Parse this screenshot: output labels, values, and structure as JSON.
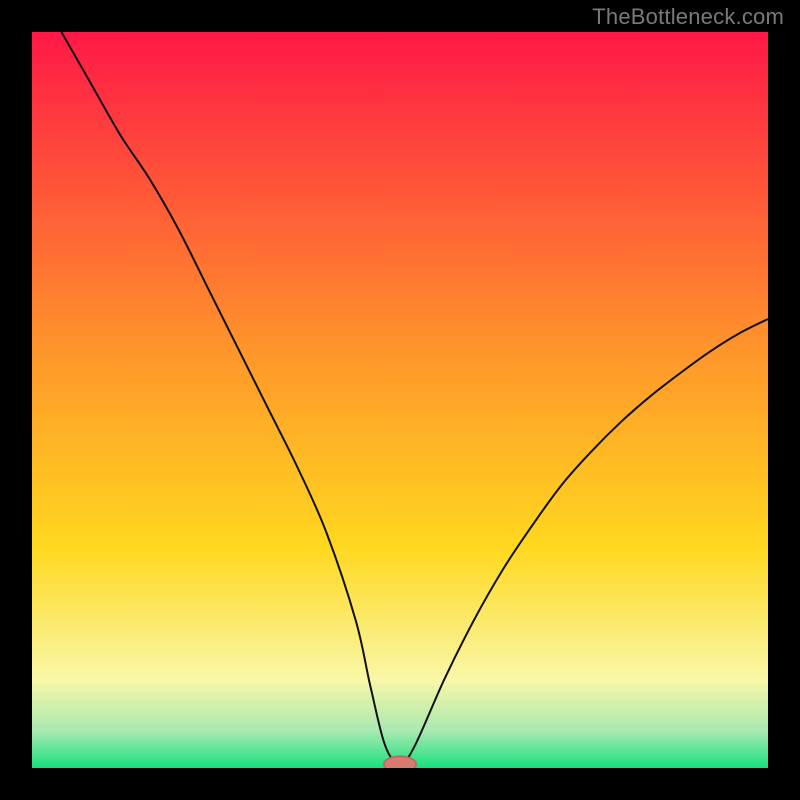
{
  "watermark": "TheBottleneck.com",
  "colors": {
    "bg": "#000000",
    "gradient_top": "#ff1846",
    "gradient_mid1": "#ff6a2e",
    "gradient_mid2": "#ffd81f",
    "gradient_mid3": "#f9f7a8",
    "gradient_mid4": "#a7e9b0",
    "gradient_bottom": "#17e07e",
    "curve": "#111111",
    "marker_fill": "#d77a70",
    "marker_stroke": "#b9665e"
  },
  "chart_data": {
    "type": "line",
    "title": "",
    "xlabel": "",
    "ylabel": "",
    "xlim": [
      0,
      100
    ],
    "ylim": [
      0,
      100
    ],
    "series": [
      {
        "name": "bottleneck-curve",
        "x": [
          4,
          8,
          12,
          16,
          20,
          24,
          28,
          32,
          36,
          40,
          44,
          46,
          48,
          50,
          52,
          56,
          60,
          64,
          68,
          72,
          76,
          80,
          84,
          88,
          92,
          96,
          100
        ],
        "values": [
          100,
          93,
          86,
          80,
          73,
          65,
          57,
          49,
          41,
          32,
          20,
          11,
          3,
          0.5,
          3,
          12,
          20,
          27,
          33,
          38.5,
          43,
          47,
          50.5,
          53.6,
          56.5,
          59,
          61
        ]
      }
    ],
    "marker": {
      "name": "minimum-point",
      "x": 50,
      "y": 0.5,
      "rx": 2.2,
      "ry": 1.1
    }
  }
}
